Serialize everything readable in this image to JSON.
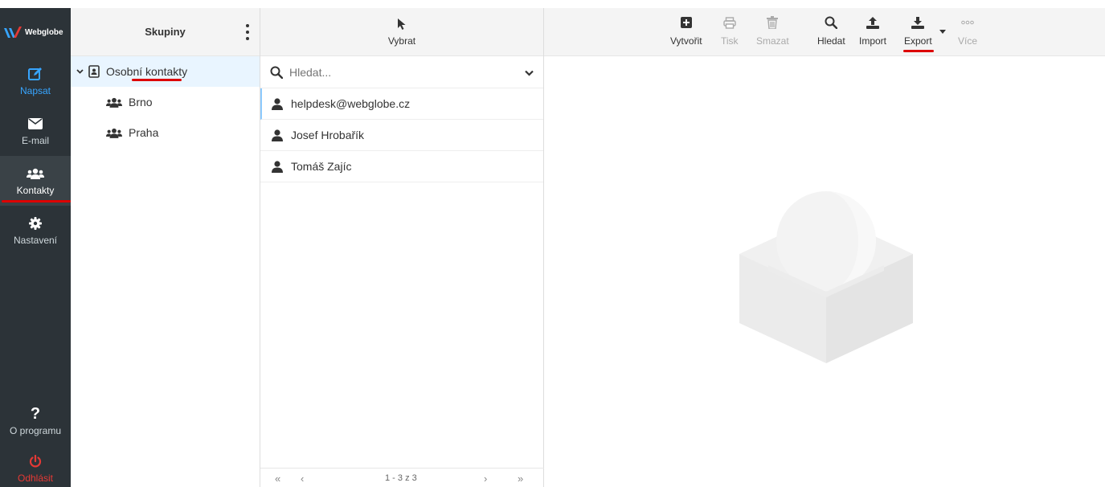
{
  "app": {
    "logo_text": "Webglobe"
  },
  "nav": {
    "compose": "Napsat",
    "email": "E-mail",
    "contacts": "Kontakty",
    "settings": "Nastavení",
    "about": "O programu",
    "logout": "Odhlásit"
  },
  "groups": {
    "title": "Skupiny",
    "items": [
      {
        "label": "Osobní kontakty"
      },
      {
        "label": "Brno"
      },
      {
        "label": "Praha"
      }
    ]
  },
  "contacts": {
    "select_label": "Vybrat",
    "search_placeholder": "Hledat...",
    "items": [
      {
        "label": "helpdesk@webglobe.cz"
      },
      {
        "label": "Josef Hrobařík"
      },
      {
        "label": "Tomáš Zajíc"
      }
    ],
    "pager": {
      "first": "«",
      "prev": "‹",
      "info": "1 - 3 z 3",
      "next": "›",
      "last": "»"
    }
  },
  "toolbar": {
    "create": "Vytvořit",
    "print": "Tisk",
    "delete": "Smazat",
    "search": "Hledat",
    "import": "Import",
    "export": "Export",
    "more": "Více"
  },
  "colors": {
    "nav_bg": "#2c3338",
    "accent": "#37a5ff",
    "logout": "#e53935",
    "underline": "#d00000"
  }
}
